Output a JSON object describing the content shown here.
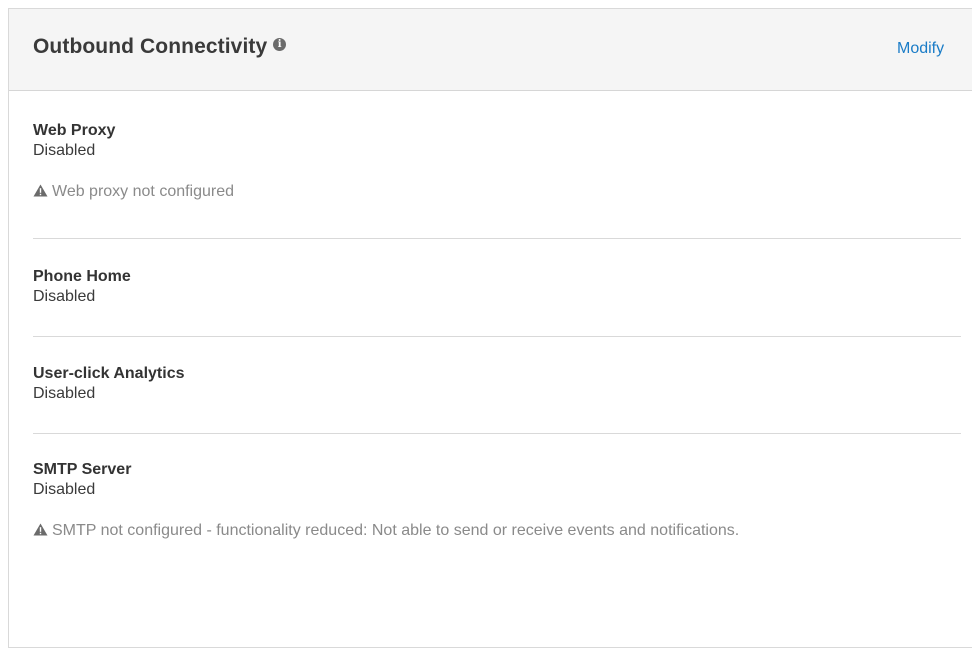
{
  "header": {
    "title": "Outbound Connectivity",
    "info_icon": "info-icon",
    "modify_label": "Modify"
  },
  "sections": [
    {
      "title": "Web Proxy",
      "value": "Disabled",
      "warning": "Web proxy not configured"
    },
    {
      "title": "Phone Home",
      "value": "Disabled"
    },
    {
      "title": "User-click Analytics",
      "value": "Disabled"
    },
    {
      "title": "SMTP Server",
      "value": "Disabled",
      "warning": "SMTP not configured - functionality reduced: Not able to send or receive events and notifications."
    }
  ],
  "colors": {
    "link": "#1a7cc7",
    "header_bg": "#f5f5f5",
    "warning_text": "#8a8a8a"
  }
}
